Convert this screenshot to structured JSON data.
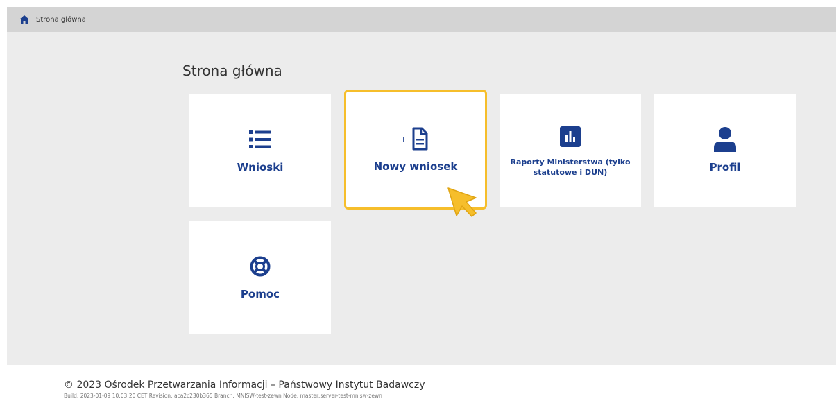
{
  "breadcrumb": {
    "home_icon": "home-icon",
    "label": "Strona główna"
  },
  "page": {
    "title": "Strona główna"
  },
  "tiles": [
    {
      "id": "wnioski",
      "label": "Wnioski",
      "icon": "list-icon"
    },
    {
      "id": "nowy-wniosek",
      "label": "Nowy wniosek",
      "icon": "new-document-icon",
      "highlighted": true
    },
    {
      "id": "raporty",
      "label": "Raporty Ministerstwa (tylko statutowe i DUN)",
      "icon": "bar-chart-icon"
    },
    {
      "id": "profil",
      "label": "Profil",
      "icon": "user-icon"
    },
    {
      "id": "pomoc",
      "label": "Pomoc",
      "icon": "life-ring-icon"
    }
  ],
  "footer": {
    "copyright": "© 2023 Ośrodek Przetwarzania Informacji – Państwowy Instytut Badawczy",
    "build": "Build: 2023-01-09 10:03:20 CET   Revision: aca2c230b365   Branch: MNISW-test-zewn   Node: master:server-test-mnisw-zewn"
  },
  "colors": {
    "accent": "#1c3f8e",
    "highlight": "#f6be2b",
    "background": "#ececec",
    "breadcrumb_bar": "#d4d4d4"
  }
}
